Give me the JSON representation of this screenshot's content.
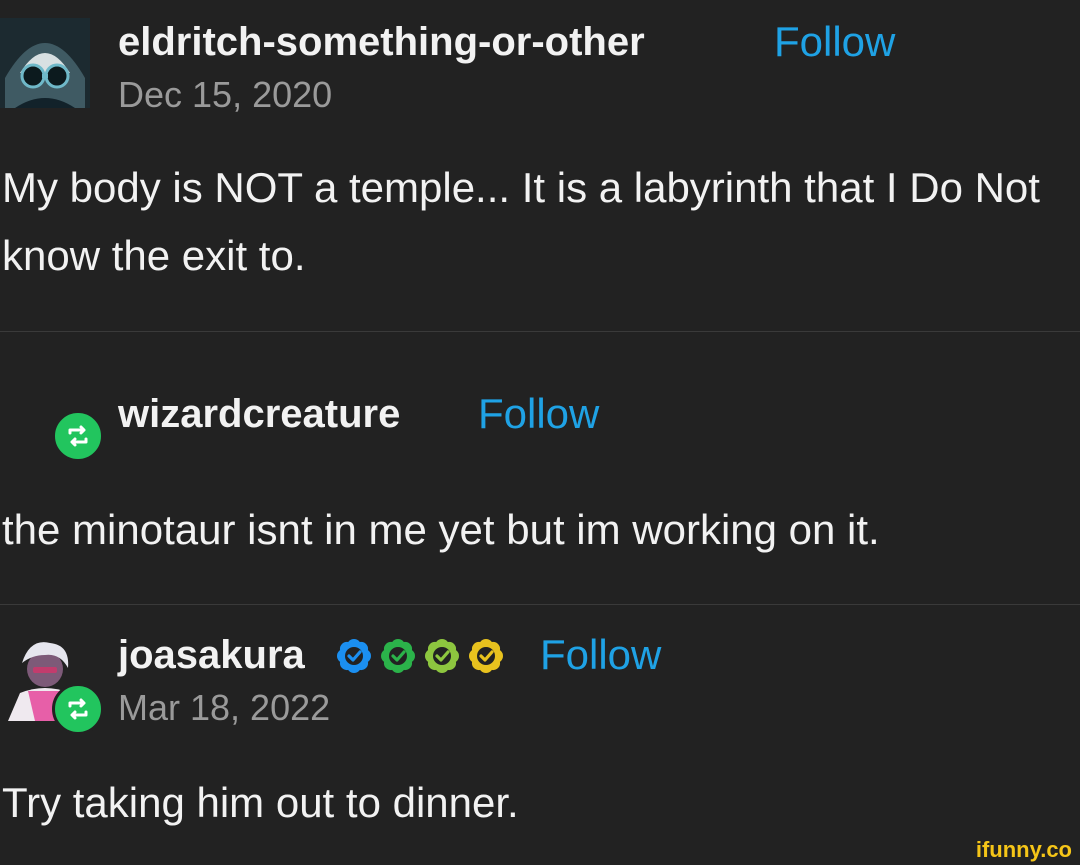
{
  "posts": [
    {
      "username": "eldritch-something-or-other",
      "follow_label": "Follow",
      "date": "Dec 15, 2020",
      "text": "My body is NOT a temple... It is a labyrinth that I Do Not know the exit to."
    },
    {
      "username": "wizardcreature",
      "follow_label": "Follow",
      "text": "the minotaur isnt in me yet but im working on it."
    },
    {
      "username": "joasakura",
      "follow_label": "Follow",
      "date": "Mar 18, 2022",
      "text": "Try taking him out to dinner.",
      "badge_colors": [
        "#1b8ff0",
        "#2bb34a",
        "#8dc63f",
        "#e8c21e"
      ]
    }
  ],
  "icons": {
    "reblog": "reblog-icon",
    "verified": "verified-badge-icon"
  },
  "colors": {
    "background": "#222222",
    "follow": "#1fa2e5",
    "reblog_green": "#22c55e",
    "date_gray": "#9a9a9a"
  },
  "watermark": "ifunny.co"
}
